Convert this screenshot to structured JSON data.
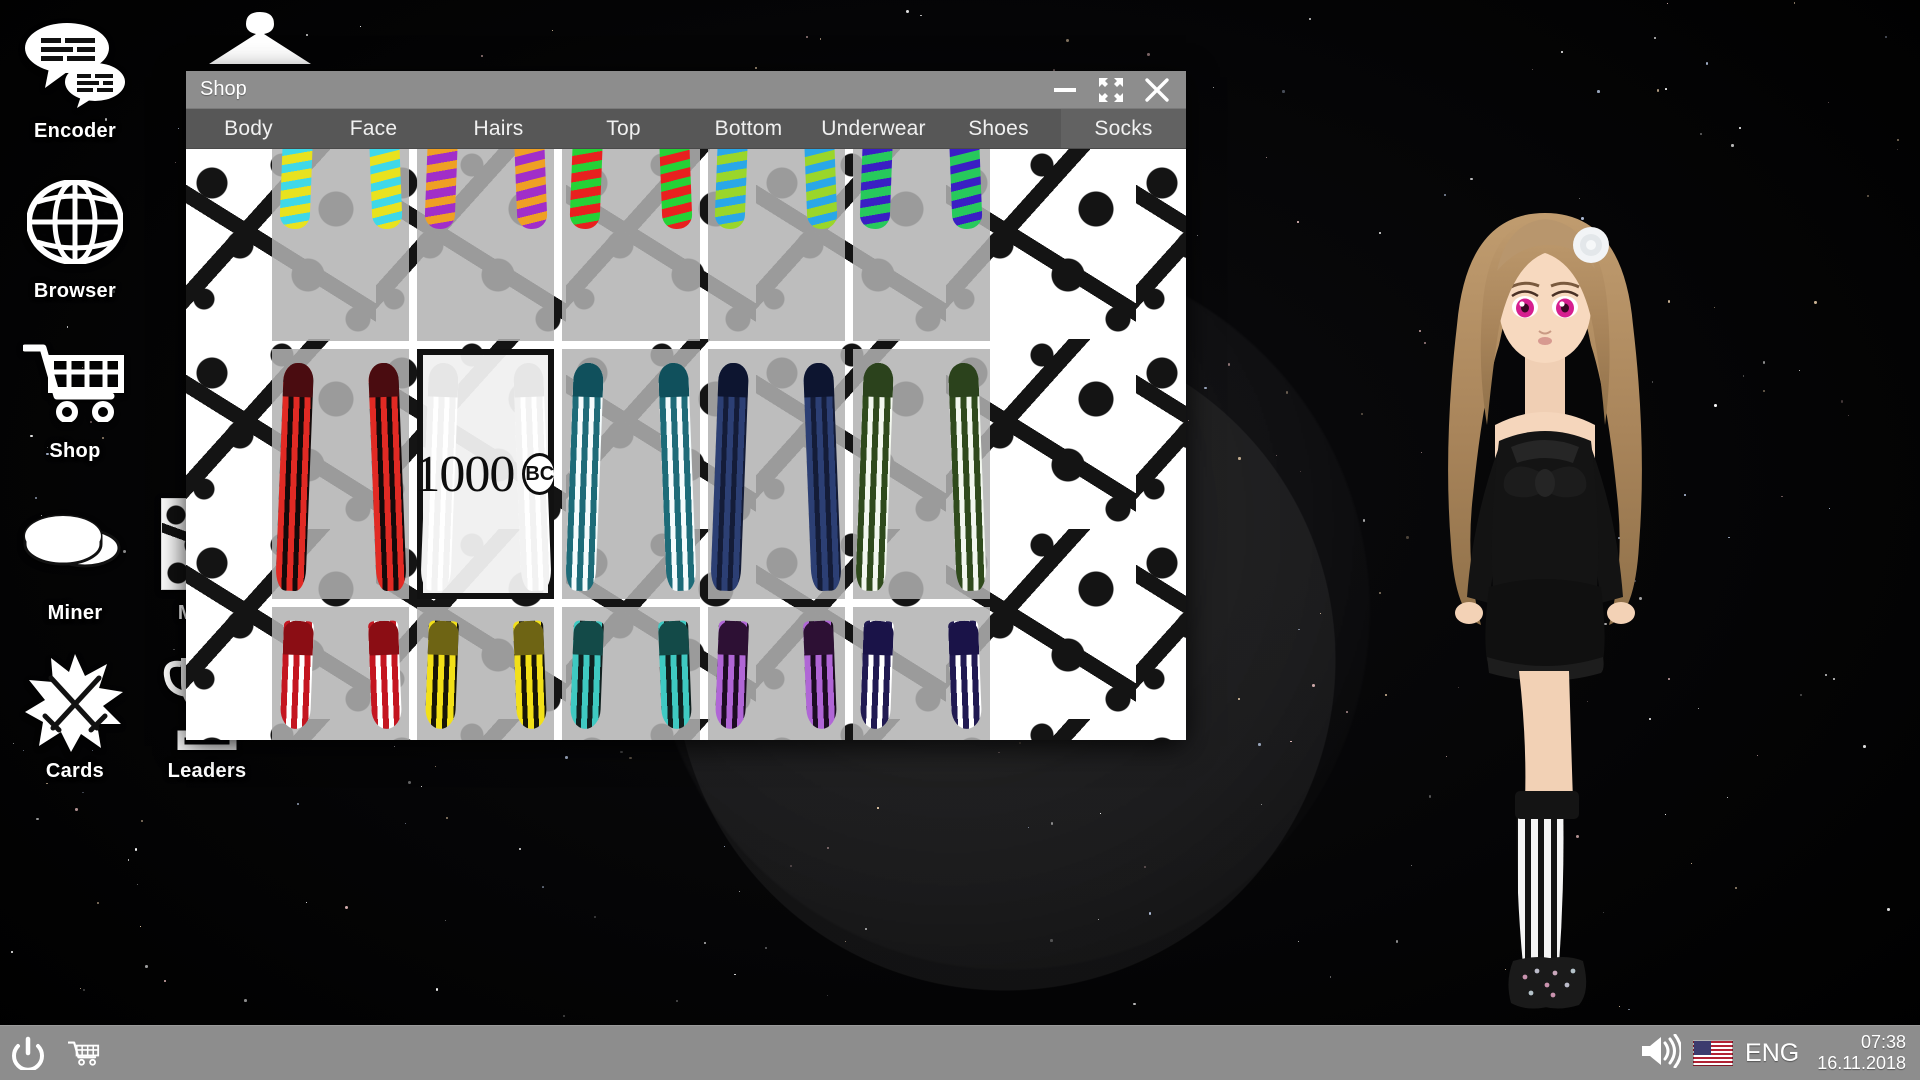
{
  "desktop": {
    "icons": [
      {
        "label": "Encoder",
        "icon": "chat-bubbles-icon"
      },
      {
        "label": "Browser",
        "icon": "globe-icon"
      },
      {
        "label": "Shop",
        "icon": "shopping-cart-icon"
      },
      {
        "label": "Miner",
        "icon": "coins-icon"
      },
      {
        "label": "Cards",
        "icon": "crossed-swords-icon"
      },
      {
        "label": "Music",
        "icon": "music-tile-icon"
      },
      {
        "label": "Leaders",
        "icon": "trophy-icon"
      }
    ]
  },
  "window": {
    "title": "Shop",
    "controls": {
      "minimize": "minimize-icon",
      "maximize": "maximize-icon",
      "close": "close-icon"
    },
    "tabs": [
      {
        "label": "Body",
        "active": false
      },
      {
        "label": "Face",
        "active": false
      },
      {
        "label": "Hairs",
        "active": false
      },
      {
        "label": "Top",
        "active": false
      },
      {
        "label": "Bottom",
        "active": false
      },
      {
        "label": "Underwear",
        "active": false
      },
      {
        "label": "Shoes",
        "active": false
      },
      {
        "label": "Socks",
        "active": true
      }
    ],
    "selected_item": {
      "price": "1000",
      "currency": "BC"
    },
    "items": [
      {
        "name": "striped-sock-yellow-cyan",
        "style": "short",
        "cuff": "#e8e21f",
        "main": "#e8e21f",
        "stripe": "#3fd8e8"
      },
      {
        "name": "striped-sock-purple-orange",
        "style": "short",
        "cuff": "#a12ec9",
        "main": "#a12ec9",
        "stripe": "#efa024"
      },
      {
        "name": "striped-sock-red-green",
        "style": "short",
        "cuff": "#e8201f",
        "main": "#e8201f",
        "stripe": "#25d236"
      },
      {
        "name": "striped-sock-green-blue",
        "style": "short",
        "cuff": "#9ad62a",
        "main": "#9ad62a",
        "stripe": "#2aa7e8"
      },
      {
        "name": "striped-sock-green-violet",
        "style": "short",
        "cuff": "#27c95c",
        "main": "#27c95c",
        "stripe": "#3a1fc4"
      },
      {
        "name": "stocking-red-black",
        "style": "long",
        "cuff": "#4a0c10",
        "main": "#e12a24",
        "stripe": "#140a0a"
      },
      {
        "name": "stocking-white",
        "style": "long",
        "cuff": "#e6e6e6",
        "main": "#f2f2f2",
        "stripe": "#ffffff",
        "selected": true
      },
      {
        "name": "stocking-teal-white",
        "style": "long",
        "cuff": "#10505c",
        "main": "#1d6b78",
        "stripe": "#f4fbfc"
      },
      {
        "name": "stocking-navy-blue",
        "style": "long",
        "cuff": "#0d1530",
        "main": "#2c3f74",
        "stripe": "#141c38"
      },
      {
        "name": "stocking-darkgreen-white",
        "style": "long",
        "cuff": "#2b421c",
        "main": "#2f4a1c",
        "stripe": "#f2f7ee"
      },
      {
        "name": "stocking-red-white",
        "style": "ankle",
        "cuff": "#8b0d14",
        "main": "#c41620",
        "stripe": "#ffffff"
      },
      {
        "name": "stocking-yellow-black",
        "style": "ankle",
        "cuff": "#6e6414",
        "main": "#f2e018",
        "stripe": "#171508"
      },
      {
        "name": "stocking-teal-black",
        "style": "ankle",
        "cuff": "#134a48",
        "main": "#3fc9c2",
        "stripe": "#10201f"
      },
      {
        "name": "stocking-purple-black",
        "style": "ankle",
        "cuff": "#2d1034",
        "main": "#b066d6",
        "stripe": "#1c0c22"
      },
      {
        "name": "stocking-navy-white",
        "style": "ankle",
        "cuff": "#1a1348",
        "main": "#211a52",
        "stripe": "#ffffff"
      }
    ]
  },
  "taskbar": {
    "power_icon": "power-icon",
    "running_apps": [
      {
        "label": "Shop",
        "icon": "shopping-cart-icon"
      }
    ],
    "tray": {
      "volume_icon": "volume-icon",
      "flag_icon": "us-flag-icon",
      "language": "ENG",
      "time": "07:38",
      "date": "16.11.2018"
    }
  },
  "avatar": {
    "name": "player-avatar",
    "hair_color": "#b08d62",
    "eye_color": "#d61f8f",
    "outfit_color": "#121212",
    "socks": "black-white-vertical-stripes"
  }
}
